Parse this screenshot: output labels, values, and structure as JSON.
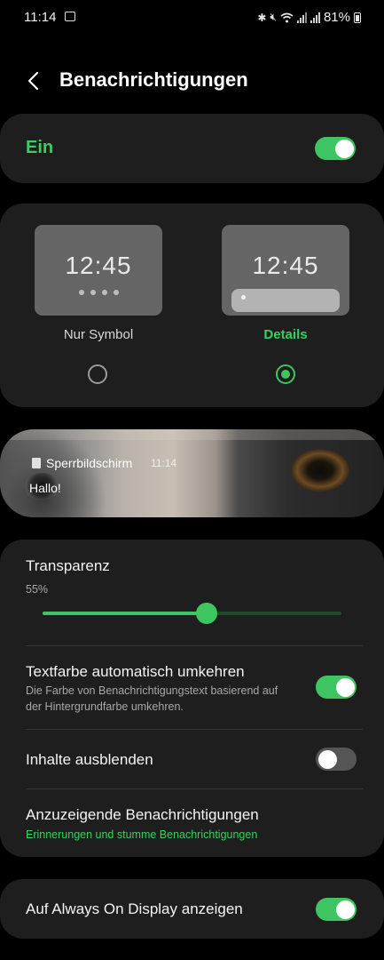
{
  "status_bar": {
    "time": "11:14",
    "battery": "81%",
    "icons": [
      "gallery-icon",
      "bluetooth-icon",
      "mute-icon",
      "wifi-icon",
      "signal-icon",
      "signal-icon",
      "battery-icon"
    ]
  },
  "header": {
    "title": "Benachrichtigungen",
    "back_icon": "back-arrow-icon"
  },
  "master": {
    "label": "Ein",
    "enabled": true
  },
  "style": {
    "options": [
      {
        "clock": "12:45",
        "label": "Nur Symbol",
        "selected": false
      },
      {
        "clock": "12:45",
        "label": "Details",
        "selected": true
      }
    ]
  },
  "preview": {
    "app": "Sperrbildschirm",
    "time": "11:14",
    "message": "Hallo!"
  },
  "settings": {
    "transparency": {
      "title": "Transparenz",
      "value_text": "55%",
      "value": 0.55
    },
    "invert_text": {
      "title": "Textfarbe automatisch umkehren",
      "subtitle": "Die Farbe von Benachrichtigungstext basierend auf der Hintergrundfarbe umkehren.",
      "enabled": true
    },
    "hide_content": {
      "title": "Inhalte ausblenden",
      "enabled": false
    },
    "shown_notifications": {
      "title": "Anzuzeigende Benachrichtigungen",
      "subtitle": "Erinnerungen und stumme Benachrichtigungen"
    }
  },
  "aod": {
    "title": "Auf Always On Display anzeigen",
    "enabled": true
  },
  "colors": {
    "accent": "#3ec562",
    "card": "#1e1e1e",
    "background": "#000000"
  }
}
